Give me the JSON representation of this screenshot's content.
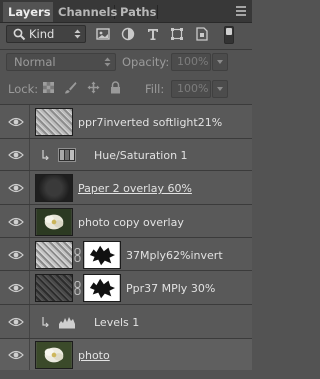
{
  "tabs": [
    {
      "label": "Layers",
      "active": true
    },
    {
      "label": "Channels",
      "active": false
    },
    {
      "label": "Paths",
      "active": false
    }
  ],
  "filter": {
    "kind_label": "Kind",
    "icons": [
      "pixel-filter-icon",
      "adjustment-filter-icon",
      "type-filter-icon",
      "shape-filter-icon",
      "smart-object-filter-icon"
    ]
  },
  "blend": {
    "mode": "Normal",
    "opacity_label": "Opacity:",
    "opacity_value": "100%"
  },
  "lock": {
    "label": "Lock:",
    "icons": [
      "lock-transparent-pixels-icon",
      "lock-image-pixels-icon",
      "lock-position-icon",
      "lock-all-icon"
    ],
    "fill_label": "Fill:",
    "fill_value": "100%"
  },
  "layers": [
    {
      "name": "ppr7inverted softlight21%",
      "type": "pixel",
      "thumb": "paper-texture",
      "clipped": false,
      "visible": true
    },
    {
      "name": "Hue/Saturation 1",
      "type": "adjustment",
      "adjustment": "hue-saturation",
      "clipped": true,
      "visible": true
    },
    {
      "name": "Paper 2 overlay 60%",
      "type": "pixel",
      "thumb": "dark-texture",
      "clipped": false,
      "visible": true,
      "underline": true
    },
    {
      "name": "photo copy overlay",
      "type": "pixel",
      "thumb": "flower",
      "clipped": false,
      "visible": true
    },
    {
      "name": "37Mply62%invert",
      "type": "masked",
      "thumb": "paper-texture",
      "mask": "black-splatter",
      "clipped": false,
      "visible": true
    },
    {
      "name": "Ppr37 MPly 30%",
      "type": "masked",
      "thumb": "dark-texture",
      "mask": "black-splatter",
      "clipped": false,
      "visible": true
    },
    {
      "name": "Levels 1",
      "type": "adjustment",
      "adjustment": "levels",
      "clipped": true,
      "visible": true
    },
    {
      "name": "photo",
      "type": "pixel",
      "thumb": "flower",
      "clipped": false,
      "visible": true,
      "underline": true
    }
  ]
}
